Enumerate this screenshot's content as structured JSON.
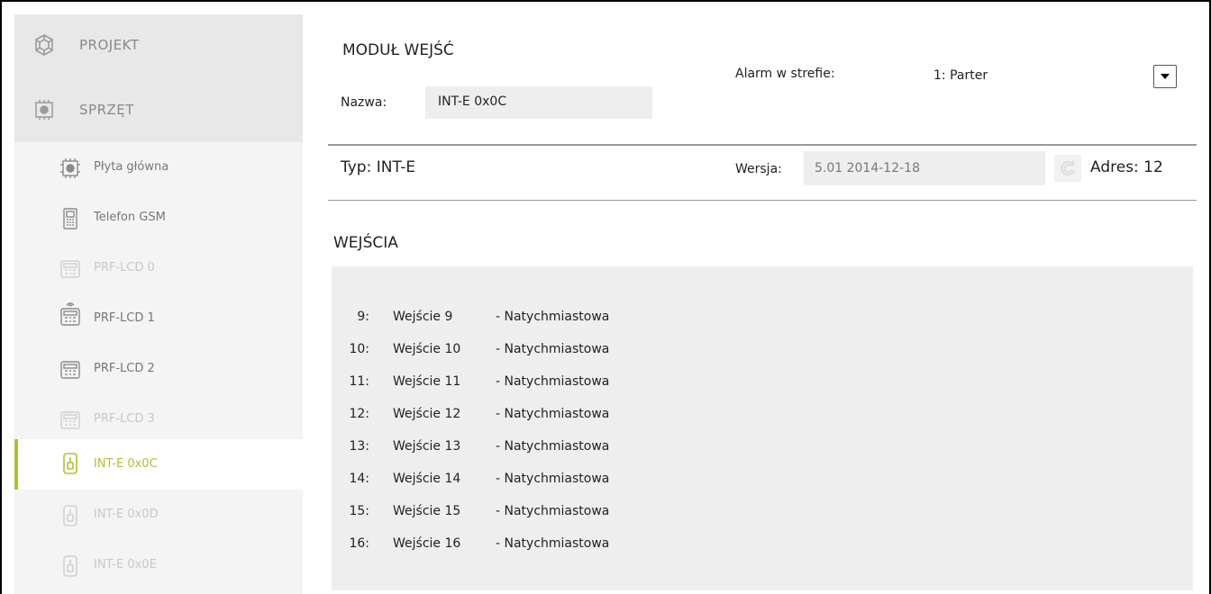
{
  "sidebar": {
    "categories": [
      {
        "label": "PROJEKT",
        "icon": "project-icon"
      },
      {
        "label": "SPRZĘT",
        "icon": "hardware-icon"
      }
    ],
    "items": [
      {
        "label": "Płyta główna",
        "icon": "mainboard-icon",
        "state": "normal"
      },
      {
        "label": "Telefon GSM",
        "icon": "gsm-phone-icon",
        "state": "normal"
      },
      {
        "label": "PRF-LCD 0",
        "icon": "keypad-icon",
        "state": "dim"
      },
      {
        "label": "PRF-LCD 1",
        "icon": "wireless-keypad-icon",
        "state": "normal"
      },
      {
        "label": "PRF-LCD 2",
        "icon": "keypad-icon",
        "state": "normal"
      },
      {
        "label": "PRF-LCD 3",
        "icon": "keypad-icon",
        "state": "dim"
      },
      {
        "label": "INT-E 0x0C",
        "icon": "module-icon",
        "state": "active"
      },
      {
        "label": "INT-E 0x0D",
        "icon": "module-icon",
        "state": "dim"
      },
      {
        "label": "INT-E 0x0E",
        "icon": "module-icon",
        "state": "dim"
      }
    ]
  },
  "header": {
    "title": "MODUŁ WEJŚĆ",
    "name_label": "Nazwa:",
    "name_value": "INT-E 0x0C",
    "alarm_label": "Alarm w strefie:",
    "alarm_value": "1: Parter"
  },
  "info": {
    "type_text": "Typ:  INT-E",
    "version_label": "Wersja:",
    "version_value": "5.01 2014-12-18",
    "address_text": "Adres: 12"
  },
  "inputs": {
    "title": "WEJŚCIA",
    "rows": [
      {
        "num": "9:",
        "name": "Wejście 9",
        "type": "- Natychmiastowa"
      },
      {
        "num": "10:",
        "name": "Wejście 10",
        "type": "- Natychmiastowa"
      },
      {
        "num": "11:",
        "name": "Wejście 11",
        "type": "- Natychmiastowa"
      },
      {
        "num": "12:",
        "name": "Wejście 12",
        "type": "- Natychmiastowa"
      },
      {
        "num": "13:",
        "name": "Wejście 13",
        "type": "- Natychmiastowa"
      },
      {
        "num": "14:",
        "name": "Wejście 14",
        "type": "- Natychmiastowa"
      },
      {
        "num": "15:",
        "name": "Wejście 15",
        "type": "- Natychmiastowa"
      },
      {
        "num": "16:",
        "name": "Wejście 16",
        "type": "- Natychmiastowa"
      }
    ]
  },
  "colors": {
    "accent": "#a8c23a",
    "panel": "#eeeeee",
    "sidebar": "#f4f4f4"
  }
}
